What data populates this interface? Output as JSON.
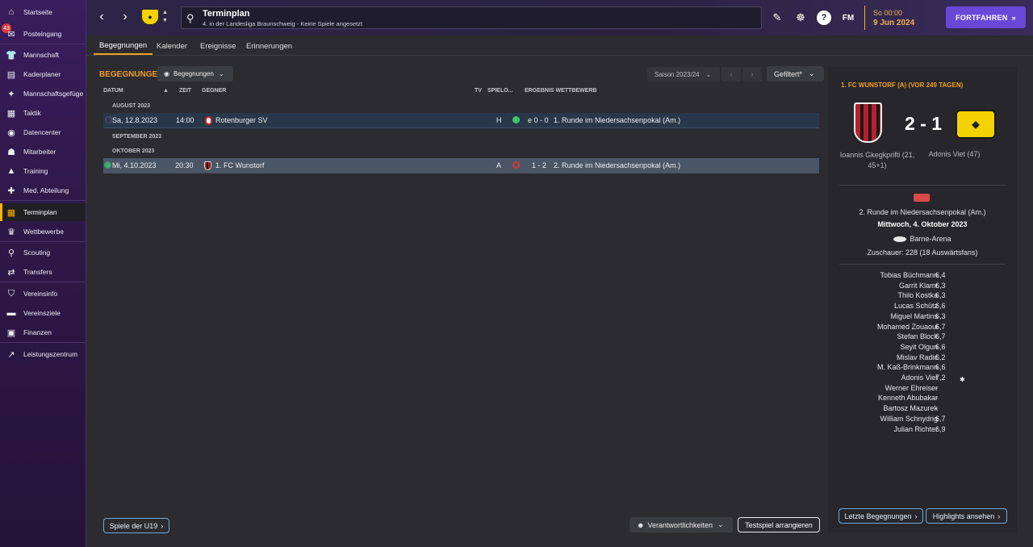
{
  "sidebar": {
    "items": [
      {
        "label": "Startseite",
        "icon": "home-icon"
      },
      {
        "label": "Posteingang",
        "icon": "inbox-icon",
        "badge": "43"
      },
      {
        "label": "Mannschaft",
        "icon": "shirt-icon"
      },
      {
        "label": "Kaderplaner",
        "icon": "clipboard-icon"
      },
      {
        "label": "Mannschaftsgefüge",
        "icon": "dynamics-icon"
      },
      {
        "label": "Taktik",
        "icon": "tactics-icon"
      },
      {
        "label": "Datencenter",
        "icon": "datacenter-icon"
      },
      {
        "label": "Mitarbeiter",
        "icon": "staff-icon"
      },
      {
        "label": "Training",
        "icon": "training-icon"
      },
      {
        "label": "Med. Abteilung",
        "icon": "medical-icon"
      },
      {
        "label": "Terminplan",
        "icon": "calendar-icon"
      },
      {
        "label": "Wettbewerbe",
        "icon": "trophy-icon"
      },
      {
        "label": "Scouting",
        "icon": "scouting-icon"
      },
      {
        "label": "Transfers",
        "icon": "transfers-icon"
      },
      {
        "label": "Vereinsinfo",
        "icon": "club-info-icon"
      },
      {
        "label": "Vereinsziele",
        "icon": "club-vision-icon"
      },
      {
        "label": "Finanzen",
        "icon": "finances-icon"
      },
      {
        "label": "Leistungszentrum",
        "icon": "dev-centre-icon"
      }
    ]
  },
  "topbar": {
    "title": "Terminplan",
    "subtitle": "4. in der Landesliga Braunschweig - Keine Spiele angesetzt",
    "fm_label": "FM",
    "time": "So 00:00",
    "date": "9 Jun 2024",
    "continue_label": "FORTFAHREN"
  },
  "tabs": [
    "Begegnungen",
    "Kalender",
    "Ereignisse",
    "Erinnerungen"
  ],
  "main": {
    "section_title": "BEGEGNUNGEN",
    "view_dropdown": "Begegnungen",
    "season": "Saison 2023/24",
    "filter": "Gefiltert*",
    "columns": {
      "date": "DATUM",
      "time": "ZEIT",
      "opponent": "GEGNER",
      "tv": "TV",
      "venue": "SPIELO...",
      "result_comp": "ERGEBNIS WETTBEWERB"
    },
    "months": [
      "AUGUST 2023",
      "SEPTEMBER 2023",
      "OKTOBER 2023"
    ],
    "matches": [
      {
        "date": "Sa, 12.8.2023",
        "time": "14:00",
        "opponent": "Rotenburger SV",
        "venue": "H",
        "result": "e 0 - 0",
        "competition": "1. Runde im Niedersachsenpokal (Am.)"
      },
      {
        "date": "Mi, 4.10.2023",
        "time": "20:30",
        "opponent": "1. FC Wunstorf",
        "venue": "A",
        "result": "1 - 2",
        "competition": "2. Runde im Niedersachsenpokal (Am.)"
      }
    ],
    "u19_button": "Spiele der U19",
    "responsibilities": "Verantwortlichkeiten",
    "friendly_button": "Testspiel arrangieren"
  },
  "details": {
    "header": "1. FC WUNSTORF (A) (VOR 249 TAGEN)",
    "score": "2 - 1",
    "home_scorer": "Ioannis Gkegkprifti (21, 45+1)",
    "away_scorer": "Adonis Viet (47)",
    "competition": "2. Runde im Niedersachsenpokal (Am.)",
    "match_date": "Mittwoch, 4. Oktober 2023",
    "stadium": "Barne-Arena",
    "attendance": "Zuschauer: 228 (18 Auswärtsfans)",
    "players": [
      {
        "name": "Tobias Büchmann",
        "rating": "6,4"
      },
      {
        "name": "Garrit Klamt",
        "rating": "6,3"
      },
      {
        "name": "Thilo Kostka",
        "rating": "6,3"
      },
      {
        "name": "Lucas Schütz",
        "rating": "6,6"
      },
      {
        "name": "Miguel Martins",
        "rating": "6,3"
      },
      {
        "name": "Mohamed Zouaoui",
        "rating": "6,7"
      },
      {
        "name": "Stefan Block",
        "rating": "6,7"
      },
      {
        "name": "Seyit Olgun",
        "rating": "6,6"
      },
      {
        "name": "Mislav Radić",
        "rating": "6,2"
      },
      {
        "name": "M. Kaß-Brinkmann",
        "rating": "6,6"
      },
      {
        "name": "Adonis Viet",
        "rating": "7,2"
      },
      {
        "name": "Werner Ehreiser",
        "rating": "-"
      },
      {
        "name": "Kenneth Abubakar",
        "rating": "-"
      },
      {
        "name": "Bartosz Mazurek",
        "rating": "-"
      },
      {
        "name": "William Schnydrig",
        "rating": "6,7"
      },
      {
        "name": "Julian Richter",
        "rating": "6,9"
      }
    ],
    "last_matches_button": "Letzte Begegnungen",
    "highlights_button": "Highlights ansehen"
  },
  "colors": {
    "accent": "#f0a020",
    "continue": "#6a48d7",
    "sidebar": "#2e1848",
    "win": "#3cc46e",
    "loss": "#d83a3a"
  }
}
